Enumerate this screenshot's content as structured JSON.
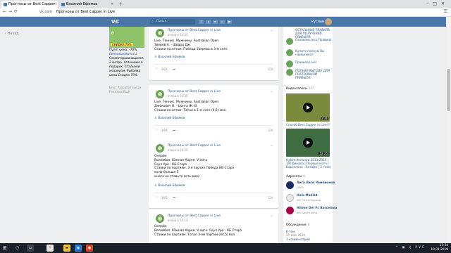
{
  "browser": {
    "tabs": [
      {
        "label": "Прогнозы от Best Capper i"
      },
      {
        "label": "Василий Ефимов"
      }
    ],
    "url_host": "vk.com",
    "url_title": "Прогнозы от Best Capper in Live"
  },
  "vk": {
    "logo": "VK",
    "search_placeholder": "Поиск",
    "user_name": "Руслан"
  },
  "left": {
    "back": "Назад",
    "ad": {
      "banner_text": "СКИДКА 70%",
      "title": "Пуля! Цены на пульверизатор!",
      "site": "famouslasstore.ru",
      "lines": [
        "Пуля! цена: -70%",
        "famouslasstore.ru",
        "Самооткрывающиеся 2 метра. Успешные в подарок. Стальной механизм. Рыбалка цена Скидка 70%"
      ]
    },
    "footer_links": [
      "Блог",
      "Разработчикам",
      "Реклама",
      "Ещё"
    ]
  },
  "posts": [
    {
      "author": "Прогнозы от Best Capper in Live",
      "date": "вчера в 14:35",
      "text": "Live. Теннис. Мужчины. Australian Open\nЗверев А. - Шварц Дж.\nСтавки по сетам: Победа Зверева в 3-м сете",
      "signer": "Василий Ефимов",
      "likes": "202",
      "views": "15K"
    },
    {
      "author": "Прогнозы от Best Capper in Live",
      "date": "вчера в 14:30",
      "text": "Live. Теннис. Мужчины. Australian Open\nДжокович Н. - Цонга Ж.-В.\nСтавки по сетам: Тотал в 1-м сете (9,5) мен",
      "signer": "Василий Ефимов",
      "likes": "194",
      "views": "13K"
    },
    {
      "author": "Прогнозы от Best Capper in Live",
      "date": "вчера в 14:20",
      "text": "Онлайн\nВолейбол. Южная Корея. V-лига\nСеул Уре - КБ Старз\nСтавки по партиям. 3-я партия Победа КБ Старз\nкоэф больше 5\nмного не ставьте есть риск",
      "signer": "Василий Ефимов",
      "likes": "185",
      "views": "12K"
    },
    {
      "author": "Прогнозы от Best Capper in Live",
      "date": "вчера в 14:13",
      "text": "Онлайн\nВолейбол. Южная Корея. V-лига. Сеул Уре - КБ Старз\nСтавки по партиям. Тотал 3-ей партии (44,5) бол",
      "signer": "",
      "likes": "",
      "views": ""
    }
  ],
  "right": {
    "links": [
      {
        "title": "ОСТАЛЬНЫЕ ПРАВИЛА ДЛЯ ПОЛУЧЕНИЯ ПРИБЫЛИ",
        "sub": ""
      },
      {
        "title": "Ознакомьтесь Правила",
        "sub": "Правила"
      },
      {
        "title": "Купите полную Вы наверняка?",
        "sub": "Выгода Телеграм"
      },
      {
        "title": "Правила Live!",
        "sub": ""
      },
      {
        "title": "ПОЛНАЯ ВЫГОДА ДЛЯ ПОСТОЯННОЙ ПРИБЫЛИ",
        "sub": ""
      }
    ],
    "videos_header": "Видеозаписи",
    "videos_count": "117",
    "videos": [
      {
        "title": "Способ Best Capper in Live!!!",
        "duration": "2:31"
      },
      {
        "title": "Кубок Испании 2013/2014 | 1/8 финала | Первый матч | Барселона - Хетафе | 2 тайм",
        "duration": "52:25"
      }
    ],
    "groups_header": "Адресаты",
    "groups_count": "6",
    "groups": [
      {
        "name": "Лига Лиги Чемпионов",
        "desc": "UEFA",
        "color": "#1a2a63"
      },
      {
        "name": "Hala Madrid",
        "desc": "ФК Реал Мадрид",
        "color": "#f0f0f0"
      },
      {
        "name": "Hilime Del Fc Barcelona",
        "desc": "ФК Барселона",
        "color": "#a50044"
      }
    ],
    "discuss_header": "Обсуждения",
    "discuss_count": "8",
    "discuss": [
      {
        "title": "6 тем",
        "sub": "27 мая 2014"
      },
      {
        "title": "1 комментарий",
        "sub": ""
      }
    ]
  },
  "taskbar": {
    "time": "13:34",
    "date": "19.01.2018",
    "lang": "РУС"
  }
}
